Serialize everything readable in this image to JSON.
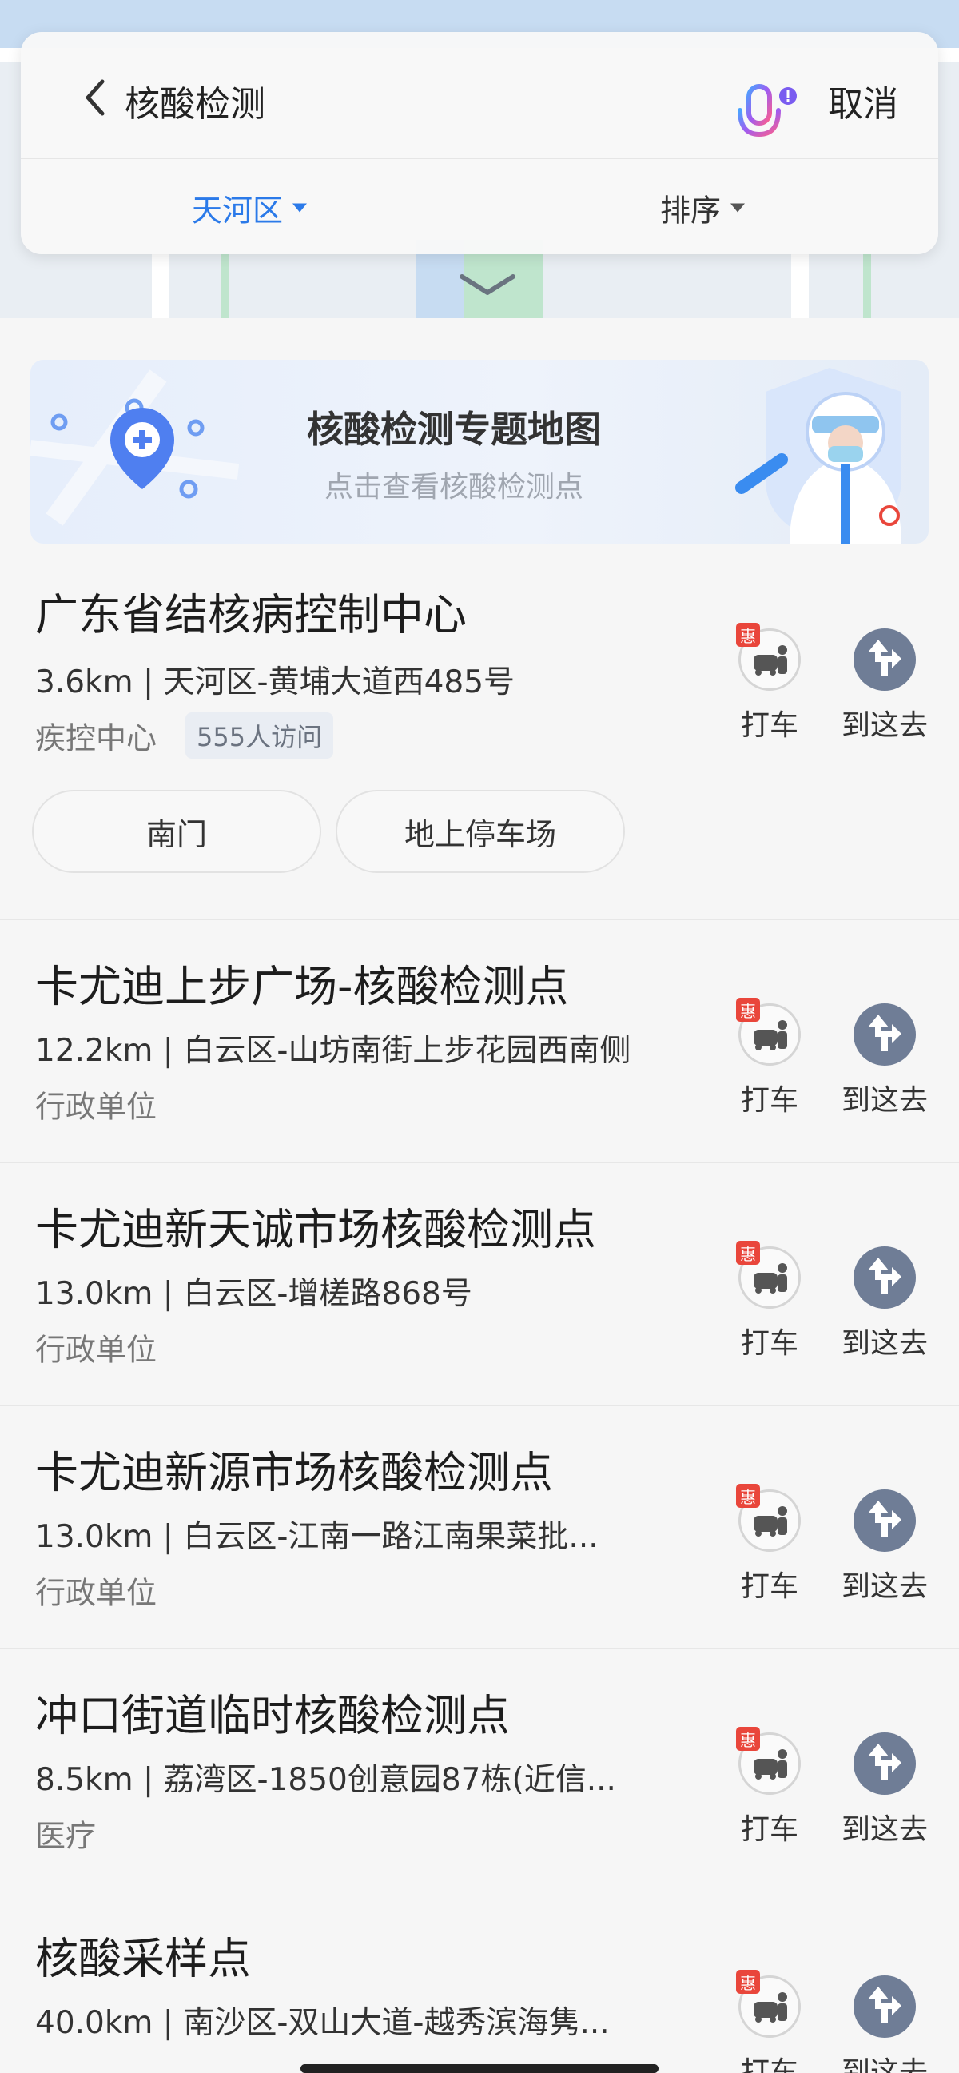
{
  "search": {
    "query": "核酸检测",
    "cancel_label": "取消"
  },
  "filters": {
    "district": "天河区",
    "sort": "排序"
  },
  "banner": {
    "title": "核酸检测专题地图",
    "subtitle": "点击查看核酸检测点"
  },
  "actions": {
    "taxi": "打车",
    "go": "到这去",
    "discount_tag": "惠"
  },
  "results": [
    {
      "name": "广东省结核病控制中心",
      "address": "3.6km | 天河区-黄埔大道西485号",
      "category": "疾控中心",
      "visits": "555人访问",
      "gates": [
        "南门",
        "地上停车场"
      ]
    },
    {
      "name": "卡尤迪上步广场-核酸检测点",
      "address": "12.2km | 白云区-山坊南街上步花园西南侧",
      "category": "行政单位"
    },
    {
      "name": "卡尤迪新天诚市场核酸检测点",
      "address": "13.0km | 白云区-增槎路868号",
      "category": "行政单位"
    },
    {
      "name": "卡尤迪新源市场核酸检测点",
      "address": "13.0km | 白云区-江南一路江南果菜批...",
      "category": "行政单位"
    },
    {
      "name": "冲口街道临时核酸检测点",
      "address": "8.5km | 荔湾区-1850创意园87栋(近信...",
      "category": "医疗"
    },
    {
      "name": "核酸采样点",
      "address": "40.0km | 南沙区-双山大道-越秀滨海隽...",
      "category": ""
    }
  ],
  "colors": {
    "accent": "#2b7ae9",
    "go_button": "#6f7d96",
    "discount": "#e9463b"
  }
}
